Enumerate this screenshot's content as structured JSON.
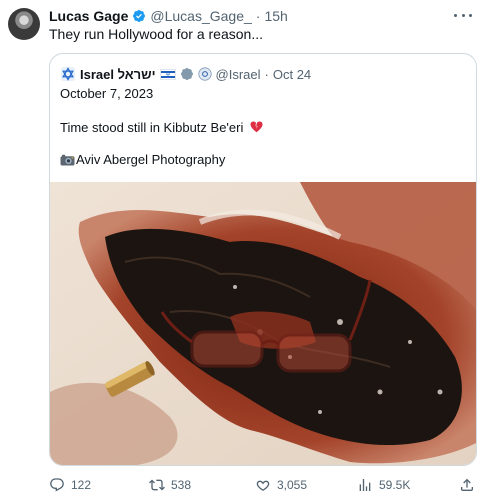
{
  "tweet": {
    "author_name": "Lucas Gage",
    "author_handle": "@Lucas_Gage_",
    "separator": "·",
    "time": "15h",
    "text": "They run Hollywood for a reason..."
  },
  "quoted_tweet": {
    "author_name": "Israel ישראל",
    "author_handle": "@Israel",
    "separator": "·",
    "date": "Oct 24",
    "line_date": "October 7, 2023",
    "line_body": "Time stood still in Kibbutz Be'eri",
    "line_credit": "Aviv Abergel Photography"
  },
  "actions": {
    "replies": "122",
    "retweets": "538",
    "likes": "3,055",
    "views": "59.5K"
  },
  "colors": {
    "text": "#0f1419",
    "secondary": "#536471",
    "verified_blue": "#1d9bf0",
    "border": "#cfd9de",
    "heart_red": "#dd2e44"
  },
  "icons": [
    "verified-badge-icon",
    "more-icon",
    "israel-flag-icon",
    "government-badge-icon",
    "broken-heart-icon",
    "camera-icon",
    "reply-icon",
    "retweet-icon",
    "like-icon",
    "views-icon",
    "share-icon"
  ]
}
